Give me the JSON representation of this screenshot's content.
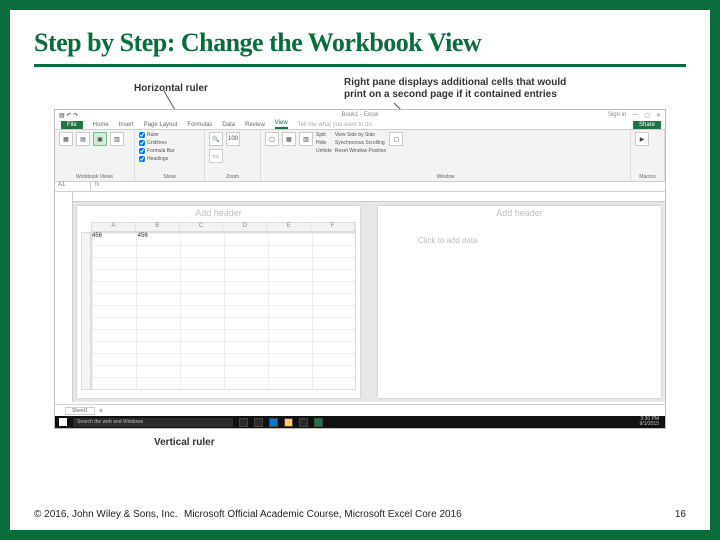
{
  "slide": {
    "title": "Step by Step: Change the Workbook View",
    "callouts": {
      "horizontal": "Horizontal ruler",
      "right_pane": "Right pane displays additional cells that would print on a second page if it contained entries",
      "vertical": "Vertical ruler"
    },
    "footer": {
      "copyright": "© 2016, John Wiley & Sons, Inc.",
      "course": "Microsoft Official Academic Course, Microsoft Excel Core 2016",
      "page": "16"
    }
  },
  "excel": {
    "titlebar": {
      "filename": "Book1 - Excel",
      "signin": "Sign in"
    },
    "tabs": {
      "file": "File",
      "home": "Home",
      "insert": "Insert",
      "pagelayout": "Page Layout",
      "formulas": "Formulas",
      "data": "Data",
      "review": "Review",
      "view": "View",
      "tell": "Tell me what you want to do",
      "share": "Share"
    },
    "ribbon": {
      "group1": "Workbook Views",
      "group2": "Show",
      "group3": "Zoom",
      "group4": "Window",
      "group5": "Macros",
      "show": {
        "ruler": "Ruler",
        "formulabar": "Formula Bar",
        "gridlines": "Gridlines",
        "headings": "Headings"
      },
      "window": {
        "new": "New Window",
        "arrange": "Arrange All",
        "freeze": "Freeze Panes",
        "split": "Split",
        "hide": "Hide",
        "unhide": "Unhide",
        "sidebyside": "View Side by Side",
        "sync": "Synchronous Scrolling",
        "reset": "Reset Window Position",
        "switch": "Switch Windows"
      }
    },
    "formula": {
      "cellref": "A1",
      "fx": "fx"
    },
    "page": {
      "addheader": "Add header",
      "clickdata": "Click to add data",
      "cols": [
        "A",
        "B",
        "C",
        "D",
        "E",
        "F"
      ],
      "data": {
        "r1c1": "456",
        "r1c2": "456"
      }
    },
    "status": {
      "sheet": "Sheet1"
    },
    "taskbar": {
      "search": "Search the web and Windows",
      "time": "3:30 PM",
      "date": "9/1/2015"
    }
  }
}
